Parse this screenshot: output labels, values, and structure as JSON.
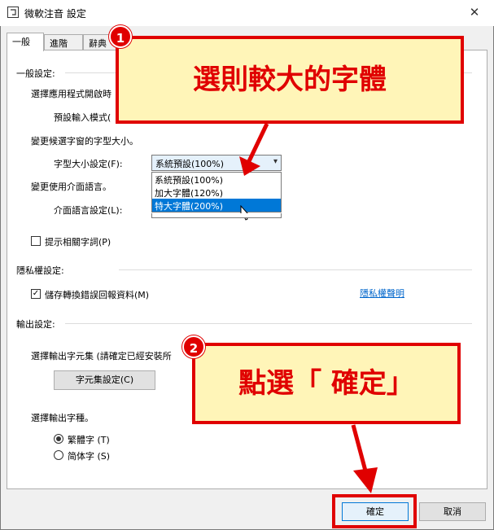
{
  "window": {
    "title": "微軟注音 設定",
    "close_icon": "✕"
  },
  "tabs": [
    {
      "label": "一般"
    },
    {
      "label": "進階"
    },
    {
      "label": "辭典"
    }
  ],
  "general": {
    "section_title": "一般設定:",
    "app_mode_label": "選擇應用程式開啟時",
    "default_mode_label": "預設輸入模式(",
    "candidate_font_label": "變更候選字窗的字型大小。",
    "font_size_label": "字型大小設定(F):",
    "font_size_selected": "系統預設(100%)",
    "font_size_options": [
      "系統預設(100%)",
      "加大字體(120%)",
      "特大字體(200%)"
    ],
    "ui_lang_label": "變更使用介面語言。",
    "ui_lang_setting_label": "介面語言設定(L):",
    "related_words_label": "提示相關字詞(P)"
  },
  "privacy": {
    "section_title": "隱私權設定:",
    "save_errors_label": "儲存轉換錯誤回報資料(M)",
    "privacy_link": "隱私權聲明"
  },
  "output": {
    "section_title": "輸出設定:",
    "charset_label": "選擇輸出字元集 (請確定已經安裝所",
    "charset_button": "字元集設定(C)",
    "char_type_label": "選擇輸出字種。",
    "traditional_label": "繁體字 (T)",
    "simplified_label": "简体字 (S)"
  },
  "footer": {
    "ok_label": "確定",
    "cancel_label": "取消"
  },
  "annotations": {
    "callout1_text": "選則較大的字體",
    "callout2_text": "點選「 確定」",
    "badge1": "1",
    "badge2": "2"
  }
}
